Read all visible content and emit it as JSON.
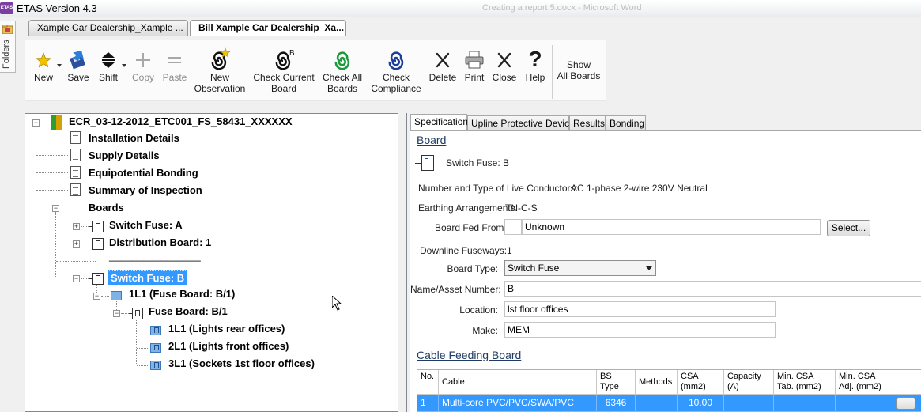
{
  "window": {
    "title": "ETAS Version 4.3",
    "logo_text": "ETAS",
    "background_title": "Creating a report 5.docx - Microsoft Word"
  },
  "folders_label": "Folders",
  "tabs": [
    {
      "label": "Xample Car Dealership_Xample ...",
      "active": false
    },
    {
      "label": "Bill Xample Car Dealership_Xa...",
      "active": true
    }
  ],
  "toolbar": {
    "new": "New",
    "save": "Save",
    "shift": "Shift",
    "copy": "Copy",
    "paste": "Paste",
    "new_observation": [
      "New",
      "Observation"
    ],
    "check_current_board": [
      "Check Current",
      "Board"
    ],
    "check_all_boards": [
      "Check All",
      "Boards"
    ],
    "check_compliance": [
      "Check",
      "Compliance"
    ],
    "delete": "Delete",
    "print": "Print",
    "close": "Close",
    "help": "Help",
    "show_all_boards": [
      "Show",
      "All Boards"
    ],
    "badge_b": "B",
    "help_glyph": "?"
  },
  "tree": {
    "root": "ECR_03-12-2012_ETC001_FS_58431_XXXXXX",
    "docs": [
      "Installation Details",
      "Supply Details",
      "Equipotential Bonding",
      "Summary of Inspection"
    ],
    "boards_label": "Boards",
    "switch_fuse_a": "Switch Fuse: A",
    "distribution_board": "Distribution Board: 1",
    "separator": "________________",
    "switch_fuse_b": "Switch Fuse: B",
    "circuit_1l1_fuse": "1L1 (Fuse Board: B/1)",
    "fuse_board": "Fuse Board: B/1",
    "circuits": [
      "1L1 (Lights rear offices)",
      "2L1 (Lights front offices)",
      "3L1 (Sockets 1st floor offices)"
    ]
  },
  "spec": {
    "tabs": [
      "Specification",
      "Upline Protective Device",
      "Results",
      "Bonding"
    ],
    "board_heading": "Board",
    "board_name": "Switch Fuse: B",
    "live_conductors_label": "Number and Type of Live Conductors:",
    "live_conductors_value": "AC 1-phase 2-wire 230V Neutral",
    "earthing_label": "Earthing Arrangements:",
    "earthing_value": "TN-C-S",
    "fed_from_label": "Board Fed From:",
    "fed_from_value": "Unknown",
    "select_button": "Select...",
    "downline_label": "Downline Fuseways:",
    "downline_value": "1",
    "board_type_label": "Board Type:",
    "board_type_value": "Switch Fuse",
    "name_label": "Name/Asset Number:",
    "name_value": "B",
    "location_label": "Location:",
    "location_value": "lst floor offices",
    "make_label": "Make:",
    "make_value": "MEM",
    "cable_heading": "Cable Feeding Board"
  },
  "cable_table": {
    "headers": [
      "No.",
      "Cable",
      "BS Type",
      "Methods",
      "CSA (mm2)",
      "Capacity (A)",
      "Min. CSA Tab. (mm2)",
      "Min. CSA Adj. (mm2)"
    ],
    "rows": [
      {
        "no": "1",
        "cable": "Multi-core PVC/PVC/SWA/PVC",
        "bs_type": "6346",
        "methods": "",
        "csa": "10.00",
        "capacity": "",
        "min_tab": "",
        "min_adj": ""
      }
    ]
  },
  "colors": {
    "selection": "#3399ff",
    "heading": "#1f3b63",
    "green_spiral": "#1a9a3a",
    "blue_spiral": "#1b3f9a"
  }
}
